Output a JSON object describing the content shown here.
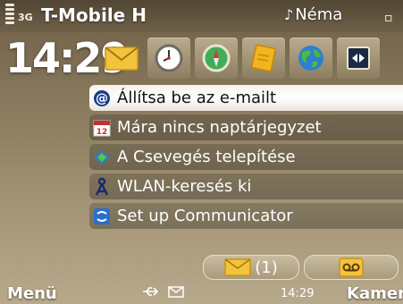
{
  "status": {
    "network_type": "3G",
    "operator": "T-Mobile H",
    "profile": "Néma",
    "profile_icon": "silent-note-icon",
    "battery_icon": "battery-icon"
  },
  "clock": {
    "time": "14:29"
  },
  "shortcuts": [
    {
      "name": "messaging-shortcut",
      "icon": "envelope-icon"
    },
    {
      "name": "clock-shortcut",
      "icon": "clock-icon"
    },
    {
      "name": "compass-shortcut",
      "icon": "compass-icon"
    },
    {
      "name": "notes-shortcut",
      "icon": "note-icon"
    },
    {
      "name": "maps-shortcut",
      "icon": "globe-icon"
    },
    {
      "name": "transfer-shortcut",
      "icon": "switch-icon"
    }
  ],
  "list": [
    {
      "label": "Állítsa be az e-mailt",
      "icon": "at-sign-icon",
      "selected": true
    },
    {
      "label": "Mára nincs naptárjegyzet",
      "icon": "calendar-icon",
      "selected": false
    },
    {
      "label": "A Csevegés telepítése",
      "icon": "chat-icon",
      "selected": false
    },
    {
      "label": "WLAN-keresés ki",
      "icon": "wlan-icon",
      "selected": false
    },
    {
      "label": "Set up Communicator",
      "icon": "communicator-icon",
      "selected": false
    }
  ],
  "notifications": {
    "messages_count": "(1)",
    "messages_icon": "envelope-icon",
    "voicemail_icon": "voicemail-icon"
  },
  "softkeys": {
    "left": "Menü",
    "right": "Kamera",
    "time": "14:29",
    "usb_icon": "usb-icon",
    "message_icon": "envelope-outline-icon"
  },
  "colors": {
    "background_top": "#6d5e45",
    "background_bottom": "#b7a98b",
    "selected_row": "#ffffff"
  }
}
